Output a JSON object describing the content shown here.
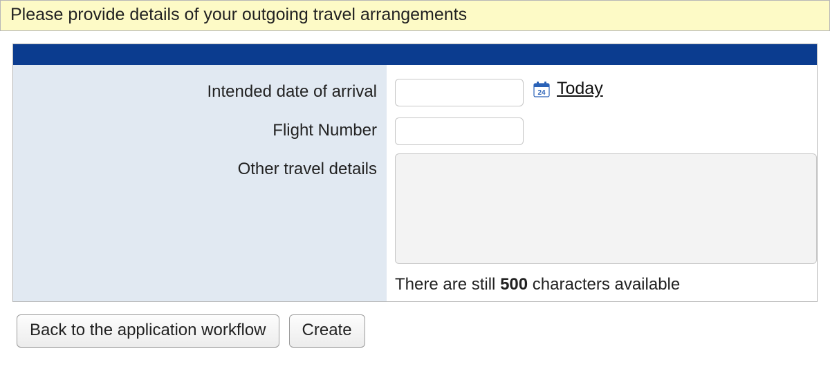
{
  "banner": {
    "text": "Please provide details of your outgoing travel arrangements"
  },
  "form": {
    "labels": {
      "arrival_date": "Intended date of arrival",
      "flight_number": "Flight Number",
      "other_details": "Other travel details"
    },
    "values": {
      "arrival_date": "",
      "flight_number": "",
      "other_details": ""
    },
    "today_link": "Today",
    "calendar_icon_day": "24",
    "char_counter": {
      "prefix": "There are still ",
      "count": "500",
      "suffix": " characters available"
    }
  },
  "buttons": {
    "back": "Back to the application workflow",
    "create": "Create"
  }
}
